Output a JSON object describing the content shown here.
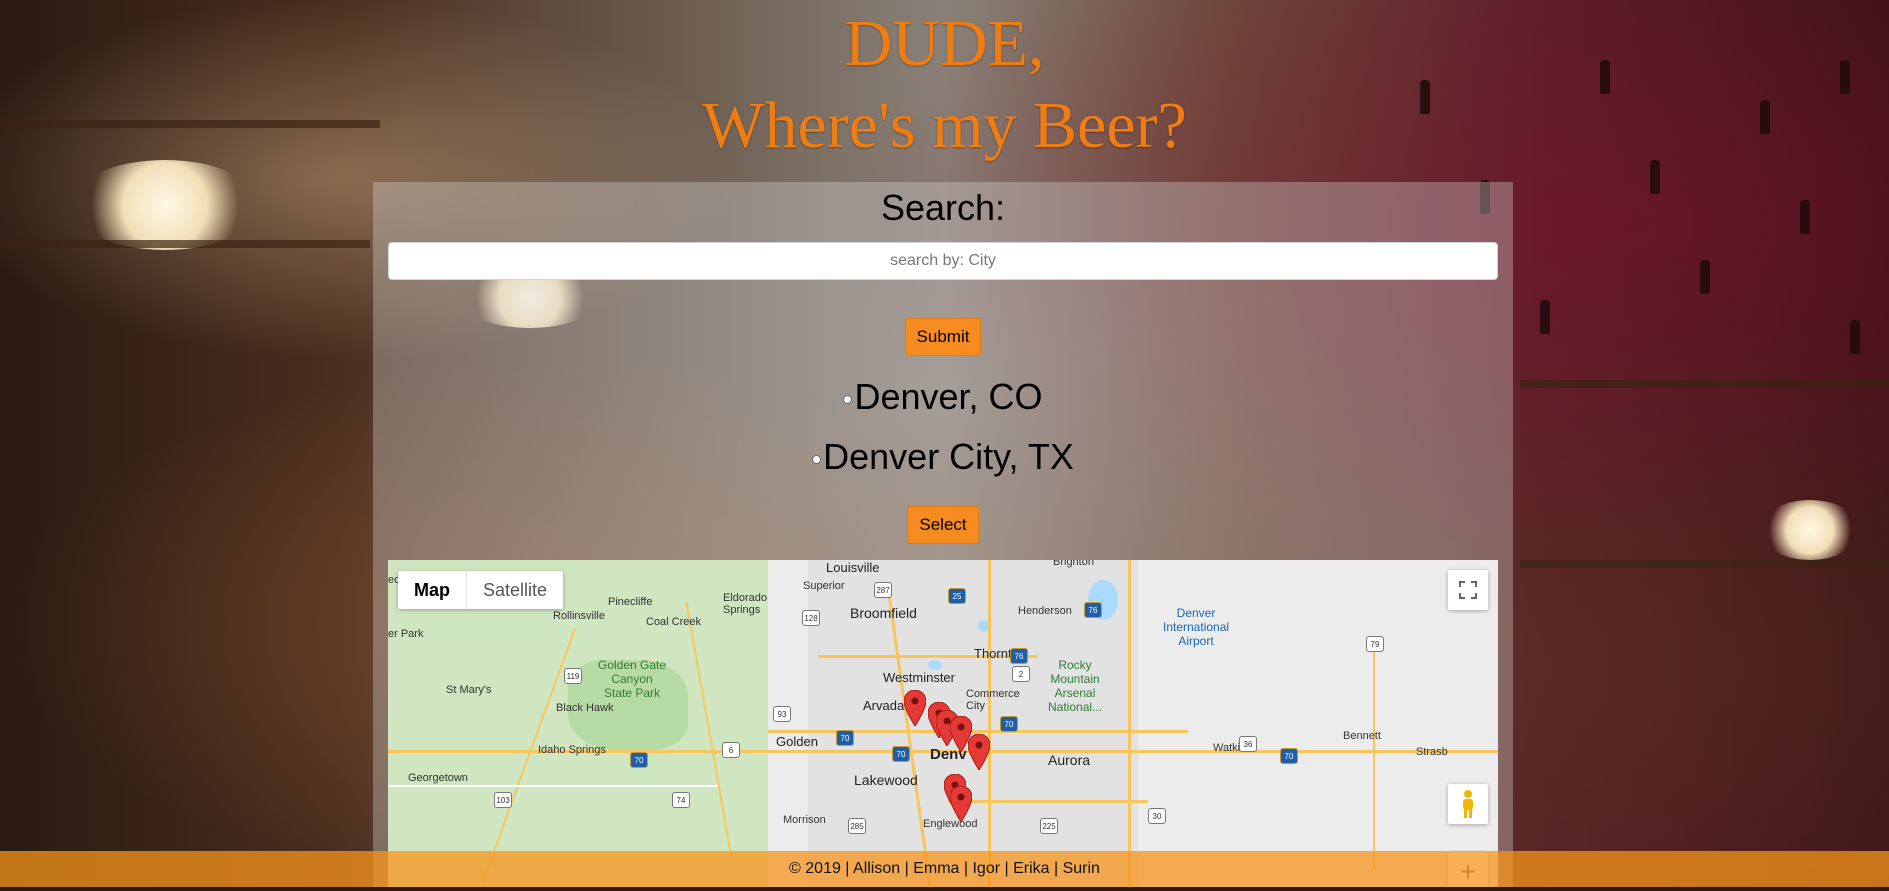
{
  "header": {
    "title_line1": "DUDE,",
    "title_line2": "Where's my Beer?"
  },
  "search": {
    "label": "Search:",
    "placeholder": "search by: City",
    "value": ""
  },
  "buttons": {
    "submit_label": "Submit",
    "select_label": "Select"
  },
  "results": [
    {
      "label": "Denver, CO"
    },
    {
      "label": "Denver City, TX"
    }
  ],
  "map": {
    "map_type_options": [
      "Map",
      "Satellite"
    ],
    "selected_map_type": "Map",
    "places": {
      "louisville": "Louisville",
      "superior": "Superior",
      "eldorado_springs": "Eldorado\nSprings",
      "broomfield": "Broomfield",
      "brighton": "Brighton",
      "henderson": "Henderson",
      "denver_airport": "Denver\nInternational\nAirport",
      "pinecliffe": "Pinecliffe",
      "rollinsville": "Rollinsville",
      "coal_creek": "Coal Creek",
      "nederland": "ederland",
      "er_park": "er Park",
      "thornton": "Thornton",
      "golden_gate": "Golden Gate\nCanyon\nState Park",
      "westminster": "Westminster",
      "rocky_mountain": "Rocky\nMountain\nArsenal\nNational...",
      "st_marys": "St Mary's",
      "black_hawk": "Black Hawk",
      "arvada": "Arvada",
      "commerce_city": "Commerce\nCity",
      "golden": "Golden",
      "denver": "Denv",
      "aurora": "Aurora",
      "idaho_springs": "Idaho Springs",
      "watkins": "Watkins",
      "bennett": "Bennett",
      "strasburg": "Strasb",
      "georgetown": "Georgetown",
      "lakewood": "Lakewood",
      "englewood": "Englewood",
      "morrison": "Morrison"
    },
    "highways": [
      "287",
      "25",
      "76",
      "128",
      "76",
      "79",
      "119",
      "2",
      "93",
      "70",
      "6",
      "70",
      "70",
      "70",
      "36",
      "70",
      "103",
      "74",
      "285",
      "225",
      "30"
    ]
  },
  "footer": {
    "text": "© 2019 | Allison | Emma | Igor | Erika | Surin"
  }
}
